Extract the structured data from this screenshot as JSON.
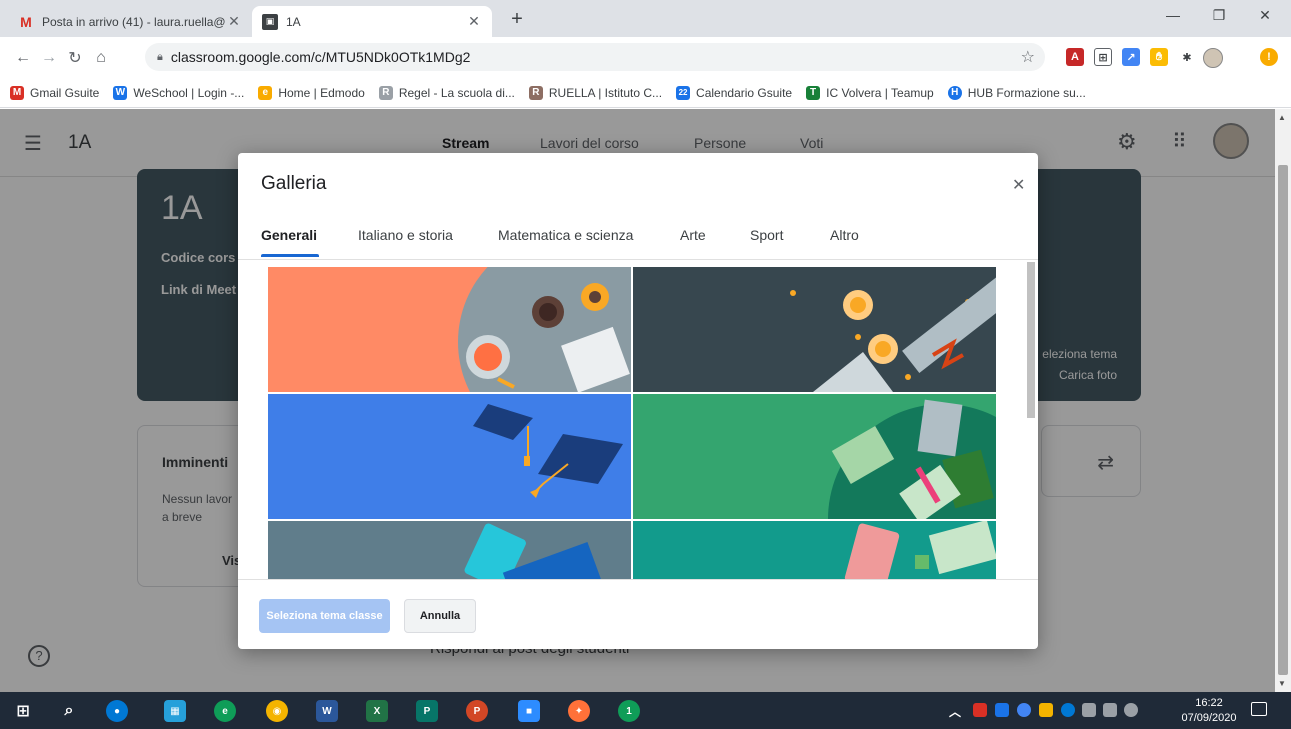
{
  "browser": {
    "tabs": [
      {
        "title": "Posta in arrivo (41) - laura.ruella@",
        "favicon": "gmail-icon"
      },
      {
        "title": "1A",
        "favicon": "classroom-icon"
      }
    ],
    "url": "classroom.google.com/c/MTU5NDk0OTk1MDg2",
    "bookmarks": [
      {
        "label": "Gmail Gsuite",
        "color": "#d93025",
        "glyph": "M"
      },
      {
        "label": "WeSchool | Login -...",
        "color": "#1a73e8",
        "glyph": "W"
      },
      {
        "label": "Home | Edmodo",
        "color": "#f9ab00",
        "glyph": "e"
      },
      {
        "label": "Regel - La scuola di...",
        "color": "#9aa0a6",
        "glyph": "R"
      },
      {
        "label": "RUELLA | Istituto C...",
        "color": "#8d6e63",
        "glyph": "R"
      },
      {
        "label": "Calendario Gsuite",
        "color": "#1a73e8",
        "glyph": "22"
      },
      {
        "label": "IC Volvera | Teamup",
        "color": "#188038",
        "glyph": "T"
      },
      {
        "label": "HUB Formazione su...",
        "color": "#1a73e8",
        "glyph": "H"
      }
    ]
  },
  "classroom": {
    "class_name": "1A",
    "nav": [
      "Stream",
      "Lavori del corso",
      "Persone",
      "Voti"
    ],
    "banner": {
      "title": "1A",
      "code_label": "Codice cors",
      "meet_label": "Link di Meet",
      "select_theme": "eleziona tema",
      "upload_photo": "Carica foto"
    },
    "upcoming": {
      "heading": "Imminenti",
      "text": "Nessun lavor a breve",
      "view": "Vis"
    },
    "post_hint": "Rispondi ai post degli studenti"
  },
  "dialog": {
    "title": "Galleria",
    "tabs": [
      "Generali",
      "Italiano e storia",
      "Matematica e scienza",
      "Arte",
      "Sport",
      "Altro"
    ],
    "active_tab": "Generali",
    "primary_button": "Seleziona tema classe",
    "cancel_button": "Annulla",
    "themes": [
      {
        "name": "coffee-theme",
        "color": "#ff8a65"
      },
      {
        "name": "diploma-theme",
        "color": "#37474f"
      },
      {
        "name": "graduation-theme",
        "color": "#3f7ee8"
      },
      {
        "name": "books-theme",
        "color": "#34a56f"
      },
      {
        "name": "laptop-theme",
        "color": "#607d8b"
      },
      {
        "name": "tablet-theme",
        "color": "#129b8c"
      }
    ]
  },
  "taskbar": {
    "time": "16:22",
    "date": "07/09/2020"
  }
}
